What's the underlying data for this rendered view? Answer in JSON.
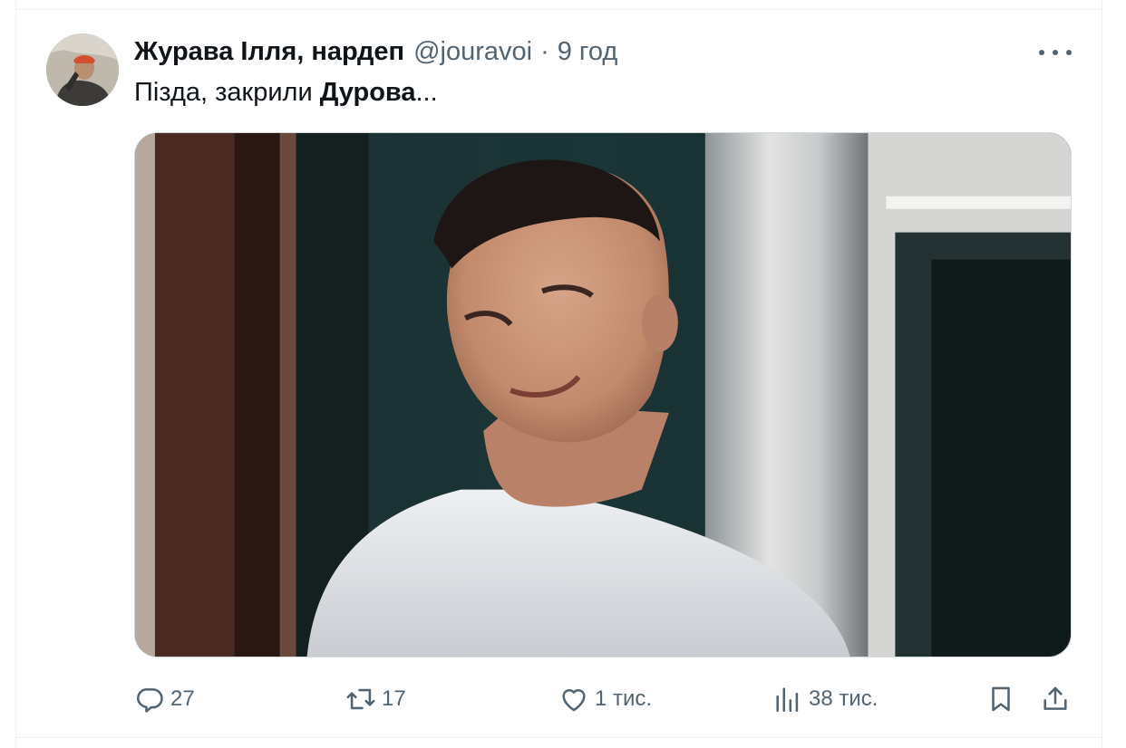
{
  "tweet": {
    "author_name": "Журава Ілля, нардеп",
    "handle": "@jouravoi",
    "separator": "·",
    "time": "9 год",
    "text_plain": "Пізда, закрили ",
    "text_bold": "Дурова",
    "text_tail": "...",
    "media_description": "Photo"
  },
  "actions": {
    "replies": "27",
    "retweets": "17",
    "likes": "1 тис.",
    "views": "38 тис."
  },
  "icons": {
    "more": "more-horizontal-icon",
    "reply": "reply-icon",
    "retweet": "retweet-icon",
    "like": "heart-icon",
    "views": "views-icon",
    "bookmark": "bookmark-icon",
    "share": "share-icon"
  },
  "colors": {
    "text_primary": "#0f1419",
    "text_secondary": "#536471",
    "border": "#eff3f4"
  }
}
